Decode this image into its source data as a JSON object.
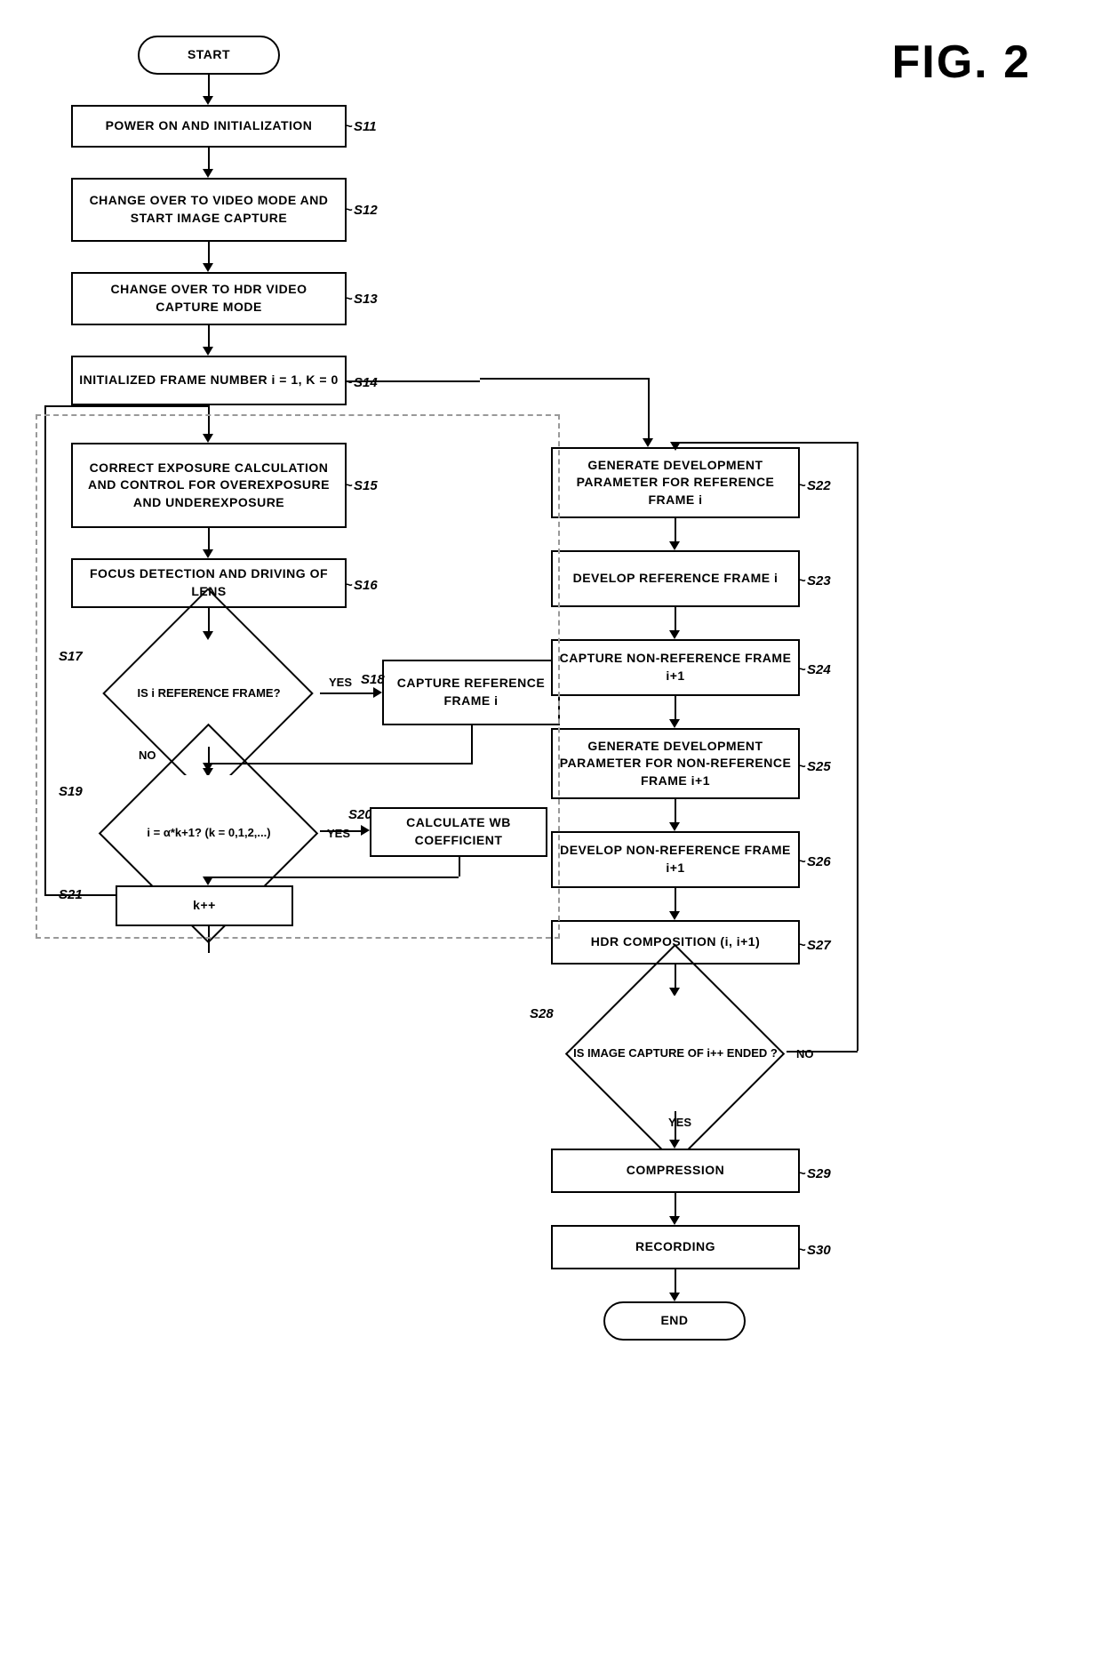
{
  "figure_label": "FIG. 2",
  "nodes": {
    "start": "START",
    "s11": "POWER ON AND INITIALIZATION",
    "s12": "CHANGE OVER TO VIDEO MODE AND START IMAGE CAPTURE",
    "s13": "CHANGE OVER TO HDR VIDEO CAPTURE MODE",
    "s14": "INITIALIZED FRAME NUMBER i = 1, K = 0",
    "s15": "CORRECT EXPOSURE CALCULATION AND CONTROL FOR OVEREXPOSURE AND UNDEREXPOSURE",
    "s16": "FOCUS DETECTION AND DRIVING OF LENS",
    "s17_diamond": "IS i REFERENCE FRAME?",
    "s18": "CAPTURE REFERENCE FRAME i",
    "s19_diamond": "i = α*k+1? (k = 0,1,2,...)",
    "s20": "CALCULATE WB COEFFICIENT",
    "s21": "k++",
    "s22": "GENERATE DEVELOPMENT PARAMETER FOR REFERENCE FRAME i",
    "s23": "DEVELOP REFERENCE FRAME i",
    "s24": "CAPTURE NON-REFERENCE FRAME i+1",
    "s25": "GENERATE DEVELOPMENT PARAMETER FOR NON-REFERENCE FRAME i+1",
    "s26": "DEVELOP NON-REFERENCE FRAME i+1",
    "s27": "HDR COMPOSITION (i, i+1)",
    "s28_diamond": "IS IMAGE CAPTURE OF i++ ENDED ?",
    "s29": "COMPRESSION",
    "s30": "RECORDING",
    "end": "END"
  },
  "step_labels": {
    "s11": "S11",
    "s12": "S12",
    "s13": "S13",
    "s14": "S14",
    "s15": "S15",
    "s16": "S16",
    "s17": "S17",
    "s18": "S18",
    "s19": "S19",
    "s20": "S20",
    "s21": "S21",
    "s22": "S22",
    "s23": "S23",
    "s24": "S24",
    "s25": "S25",
    "s26": "S26",
    "s27": "S27",
    "s28": "S28",
    "s29": "S29",
    "s30": "S30"
  },
  "yes_no": {
    "yes": "YES",
    "no": "NO"
  }
}
